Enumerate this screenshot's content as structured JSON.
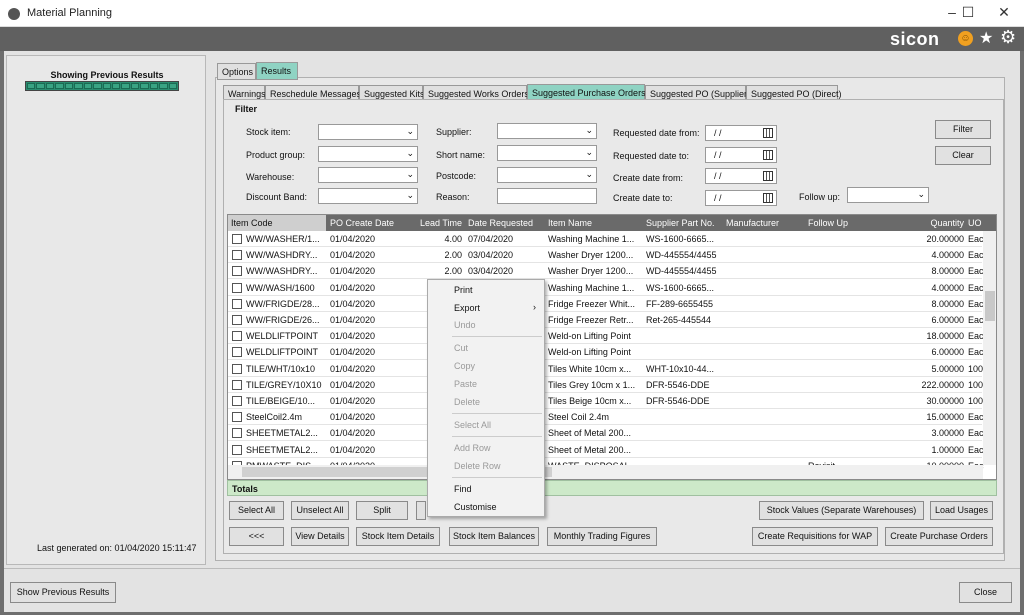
{
  "window": {
    "title": "Material Planning",
    "minimize": "–",
    "maximize": "☐",
    "close": "✕"
  },
  "brand": {
    "logo": "sicon",
    "icons": [
      "smiley-icon",
      "star-icon",
      "gear-icon"
    ]
  },
  "left": {
    "showing": "Showing Previous Results",
    "generated": "Last generated on: 01/04/2020 15:11:47",
    "show_prev_button": "Show Previous Results"
  },
  "top_tabs": [
    "Options",
    "Results"
  ],
  "sub_tabs": [
    "Warnings",
    "Reschedule Messages",
    "Suggested Kits",
    "Suggested Works Orders",
    "Suggested Purchase Orders",
    "Suggested PO (Supplier)",
    "Suggested PO (Direct)"
  ],
  "filter": {
    "title": "Filter",
    "labels": {
      "stock_item": "Stock item:",
      "product_group": "Product group:",
      "warehouse": "Warehouse:",
      "discount_band": "Discount Band:",
      "supplier": "Supplier:",
      "short_name": "Short name:",
      "postcode": "Postcode:",
      "reason": "Reason:",
      "req_from": "Requested date from:",
      "req_to": "Requested date to:",
      "create_from": "Create date from:",
      "create_to": "Create date to:",
      "follow_up": "Follow up:"
    },
    "date_placeholder": "/ /",
    "filter_button": "Filter",
    "clear_button": "Clear"
  },
  "grid": {
    "columns": [
      "Item Code",
      "PO Create Date",
      "Lead Time",
      "Date Requested",
      "Item Name",
      "Supplier Part No.",
      "Manufacturer",
      "Follow Up",
      "Quantity",
      "UO"
    ],
    "rows": [
      [
        "WW/WASHER/1...",
        "01/04/2020",
        "4.00",
        "07/04/2020",
        "Washing Machine 1...",
        "WS-1600-6665...",
        "",
        "",
        "20.00000",
        "Eac"
      ],
      [
        "WW/WASHDRY...",
        "01/04/2020",
        "2.00",
        "03/04/2020",
        "Washer Dryer 1200...",
        "WD-445554/4455",
        "",
        "",
        "4.00000",
        "Eac"
      ],
      [
        "WW/WASHDRY...",
        "01/04/2020",
        "2.00",
        "03/04/2020",
        "Washer Dryer 1200...",
        "WD-445554/4455",
        "",
        "",
        "8.00000",
        "Eac"
      ],
      [
        "WW/WASH/1600",
        "01/04/2020",
        "",
        "",
        "Washing Machine 1...",
        "WS-1600-6665...",
        "",
        "",
        "4.00000",
        "Eac"
      ],
      [
        "WW/FRIGDE/28...",
        "01/04/2020",
        "",
        "",
        "Fridge Freezer Whit...",
        "FF-289-6655455",
        "",
        "",
        "8.00000",
        "Eac"
      ],
      [
        "WW/FRIGDE/26...",
        "01/04/2020",
        "",
        "",
        "Fridge Freezer Retr...",
        "Ret-265-445544",
        "",
        "",
        "6.00000",
        "Eac"
      ],
      [
        "WELDLIFTPOINT",
        "01/04/2020",
        "",
        "",
        "Weld-on Lifting Point",
        "",
        "",
        "",
        "18.00000",
        "Eac"
      ],
      [
        "WELDLIFTPOINT",
        "01/04/2020",
        "",
        "",
        "Weld-on Lifting Point",
        "",
        "",
        "",
        "6.00000",
        "Eac"
      ],
      [
        "TILE/WHT/10x10",
        "01/04/2020",
        "",
        "",
        "Tiles White 10cm x...",
        "WHT-10x10-44...",
        "",
        "",
        "5.00000",
        "100"
      ],
      [
        "TILE/GREY/10X10",
        "01/04/2020",
        "",
        "",
        "Tiles Grey 10cm x 1...",
        "DFR-5546-DDE",
        "",
        "",
        "222.00000",
        "100"
      ],
      [
        "TILE/BEIGE/10...",
        "01/04/2020",
        "",
        "",
        "Tiles Beige 10cm x...",
        "DFR-5546-DDE",
        "",
        "",
        "30.00000",
        "100"
      ],
      [
        "SteelCoil2.4m",
        "01/04/2020",
        "",
        "",
        "Steel Coil 2.4m",
        "",
        "",
        "",
        "15.00000",
        "Eac"
      ],
      [
        "SHEETMETAL2...",
        "01/04/2020",
        "",
        "",
        "Sheet of Metal 200...",
        "",
        "",
        "",
        "3.00000",
        "Eac"
      ],
      [
        "SHEETMETAL2...",
        "01/04/2020",
        "",
        "",
        "Sheet of Metal 200...",
        "",
        "",
        "",
        "1.00000",
        "Eac"
      ],
      [
        "PMWASTE_DIS...",
        "01/04/2020",
        "",
        "",
        "WASTE_DISPOSAL...",
        "",
        "",
        "Revisit",
        "10.00000",
        "Eac"
      ]
    ],
    "totals_label": "Totals"
  },
  "context_menu": {
    "items": [
      {
        "label": "Print",
        "enabled": true
      },
      {
        "label": "Export",
        "enabled": true,
        "submenu": "›"
      },
      {
        "label": "Undo",
        "enabled": false
      },
      {
        "label": "Cut",
        "enabled": false
      },
      {
        "label": "Copy",
        "enabled": false
      },
      {
        "label": "Paste",
        "enabled": false
      },
      {
        "label": "Delete",
        "enabled": false
      },
      {
        "label": "Select All",
        "enabled": false
      },
      {
        "label": "Add Row",
        "enabled": false
      },
      {
        "label": "Delete Row",
        "enabled": false
      },
      {
        "label": "Find",
        "enabled": true
      },
      {
        "label": "Customise",
        "enabled": true
      }
    ]
  },
  "buttons": {
    "select_all": "Select All",
    "unselect_all": "Unselect All",
    "split": "Split",
    "back": "<<<",
    "view_details": "View Details",
    "stock_item_details": "Stock Item Details",
    "stock_item_balances": "Stock Item Balances",
    "monthly_trading": "Monthly Trading Figures",
    "stock_values": "Stock Values (Separate Warehouses)",
    "load_usages": "Load Usages",
    "create_requisitions": "Create Requisitions for WAP",
    "create_pos": "Create Purchase Orders",
    "close": "Close"
  },
  "colors": {
    "active_tab": "#8fd3c3",
    "header": "#6a6a6a",
    "totals": "#cde9c9",
    "progress": "#2a8b6f"
  }
}
